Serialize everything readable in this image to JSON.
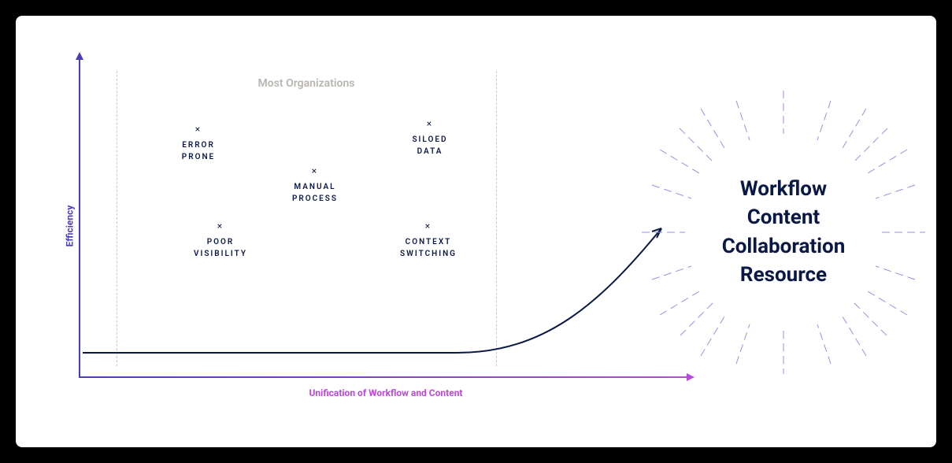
{
  "chart_data": {
    "type": "line",
    "xlabel": "Unification of Workflow and Content",
    "ylabel": "Efficiency",
    "zone_label": "Most Organizations",
    "scatter_points": [
      {
        "label": "ERROR PRONE"
      },
      {
        "label": "MANUAL PROCESS"
      },
      {
        "label": "SILOED DATA"
      },
      {
        "label": "POOR VISIBILITY"
      },
      {
        "label": "CONTEXT SWITCHING"
      }
    ],
    "destination_title_lines": [
      "Workflow",
      "Content",
      "Collaboration",
      "Resource"
    ]
  },
  "points": {
    "error": {
      "l1": "ERROR",
      "l2": "PRONE"
    },
    "manual": {
      "l1": "MANUAL",
      "l2": "PROCESS"
    },
    "siloed": {
      "l1": "SILOED",
      "l2": "DATA"
    },
    "poor": {
      "l1": "POOR",
      "l2": "VISIBILITY"
    },
    "context": {
      "l1": "CONTEXT",
      "l2": "SWITCHING"
    }
  },
  "burst": {
    "l1": "Workflow",
    "l2": "Content",
    "l3": "Collaboration",
    "l4": "Resource"
  }
}
